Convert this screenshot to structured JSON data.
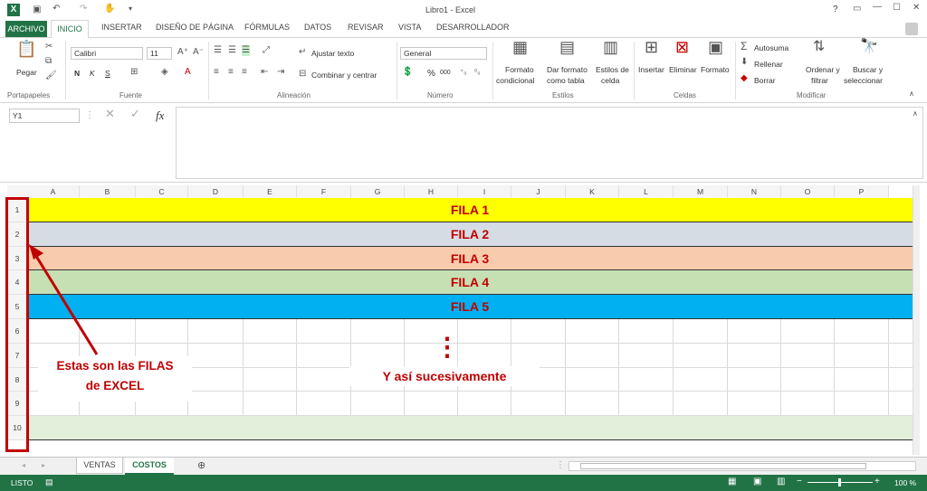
{
  "title": "Libro1 - Excel",
  "qat": {
    "help": "?"
  },
  "tabs": [
    "ARCHIVO",
    "INICIO",
    "INSERTAR",
    "DISEÑO DE PÁGINA",
    "FÓRMULAS",
    "DATOS",
    "REVISAR",
    "VISTA",
    "DESARROLLADOR"
  ],
  "ribbon": {
    "paste": "Pegar",
    "font_name": "Calibri",
    "font_size": "11",
    "bold": "N",
    "italic": "K",
    "underline": "S",
    "wrap_text": "Ajustar texto",
    "merge_center": "Combinar y centrar",
    "number_format": "General",
    "percent": "%",
    "thousands": "000",
    "cond_format_1": "Formato",
    "cond_format_2": "condicional",
    "format_table_1": "Dar formato",
    "format_table_2": "como tabla",
    "cell_styles_1": "Estilos de",
    "cell_styles_2": "celda",
    "insert": "Insertar",
    "delete": "Eliminar",
    "format": "Formato",
    "autosum": "Autosuma",
    "fill": "Rellenar",
    "clear": "Borrar",
    "sort_1": "Ordenar y",
    "sort_2": "filtrar",
    "find_1": "Buscar y",
    "find_2": "seleccionar",
    "groups": [
      "Portapapeles",
      "Fuente",
      "Alineación",
      "Número",
      "Estilos",
      "Celdas",
      "Modificar"
    ]
  },
  "formula_bar": {
    "name_box": "Y1",
    "fx": "fx",
    "value": ""
  },
  "columns": [
    "A",
    "B",
    "C",
    "D",
    "E",
    "F",
    "G",
    "H",
    "I",
    "J",
    "K",
    "L",
    "M",
    "N",
    "O",
    "P"
  ],
  "rows": [
    "1",
    "2",
    "3",
    "4",
    "5",
    "6",
    "7",
    "8",
    "9",
    "10"
  ],
  "row_labels": [
    "FILA 1",
    "FILA 2",
    "FILA 3",
    "FILA 4",
    "FILA 5"
  ],
  "row_colors": [
    "#ffff00",
    "#d6dce4",
    "#f8cbad",
    "#c6e0b4",
    "#00b0f0",
    "#ffffff",
    "#ffffff",
    "#ffffff",
    "#ffffff",
    "#e2efda"
  ],
  "annotation_left_1": "Estas son las FILAS",
  "annotation_left_2": "de EXCEL",
  "annotation_dots": "⋮",
  "annotation_right": "Y así sucesivamente",
  "sheets": [
    "VENTAS",
    "COSTOS"
  ],
  "status": {
    "state": "LISTO",
    "zoom": "100 %"
  },
  "accent": "#217346",
  "annotation_color": "#c00000"
}
